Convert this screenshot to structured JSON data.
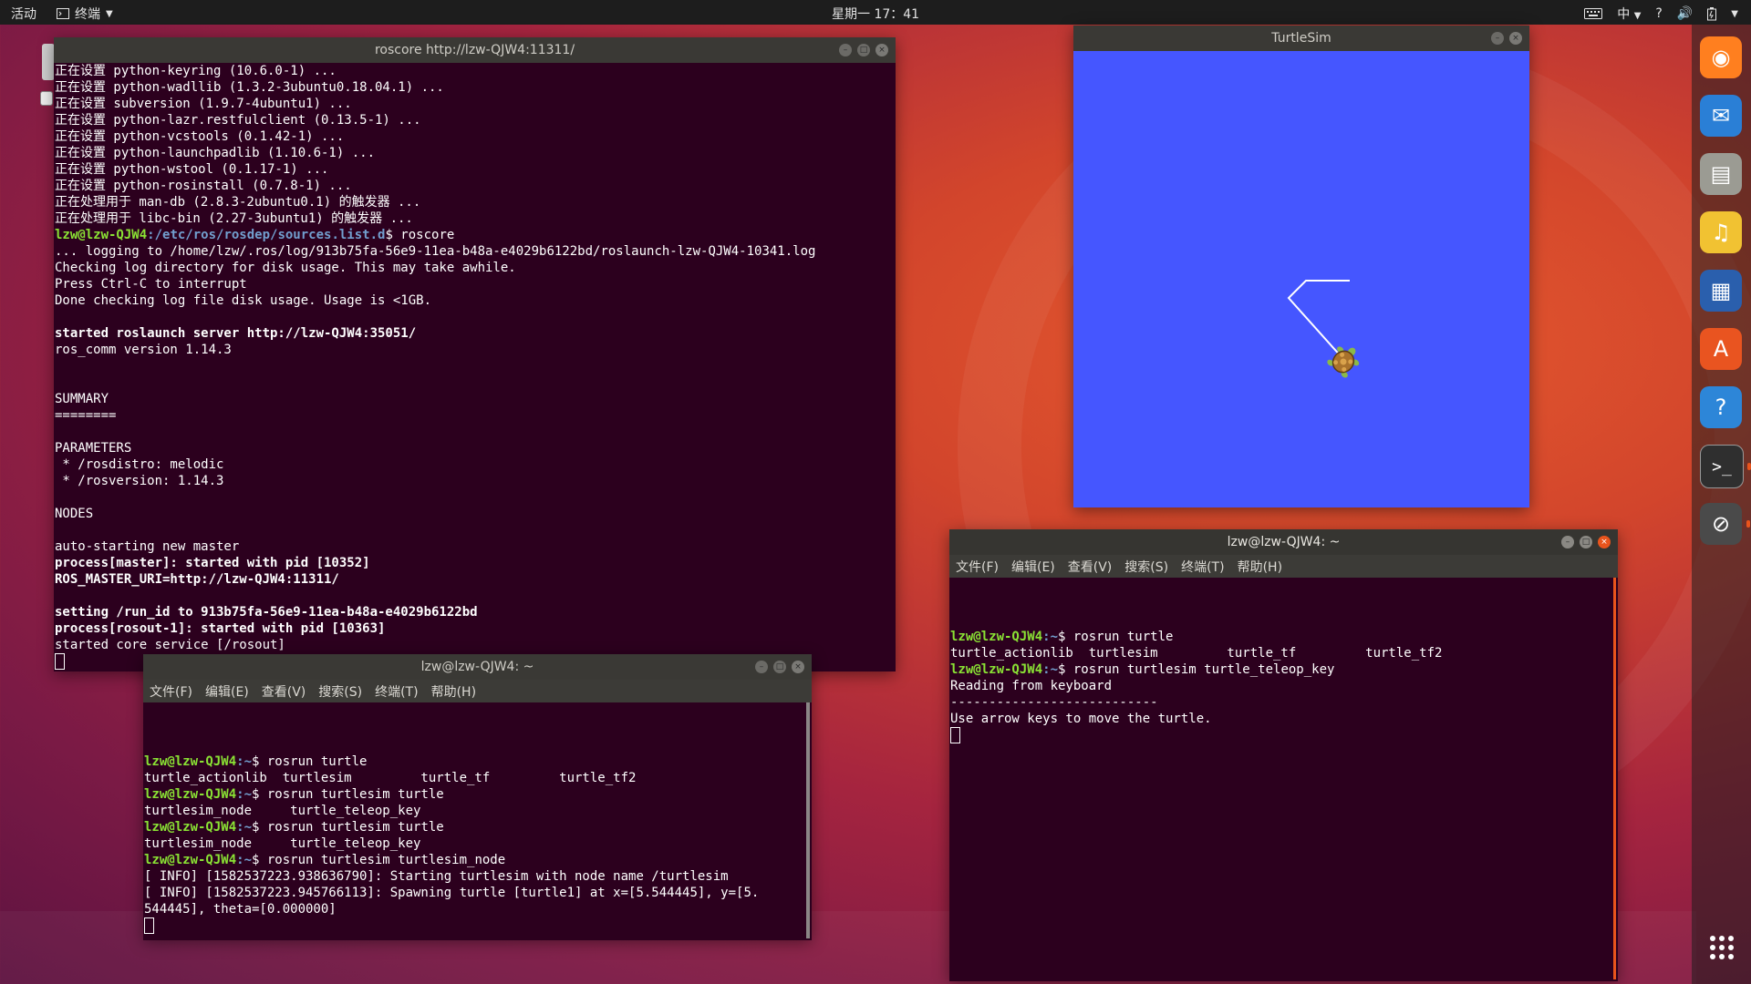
{
  "topbar": {
    "activities": "活动",
    "app_menu": "终端",
    "clock": "星期一 17：41",
    "tray": {
      "keyboard_icon": "keyboard-icon",
      "input_method": "中",
      "help": "?",
      "volume_icon": "volume-icon",
      "battery_icon": "battery-icon",
      "system_menu_icon": "chevron-down-icon"
    }
  },
  "dock": {
    "items": [
      {
        "name": "firefox",
        "icon": "firefox-icon",
        "color": "#ff7f1f"
      },
      {
        "name": "thunderbird",
        "icon": "mail-icon",
        "color": "#2a7fd6"
      },
      {
        "name": "files",
        "icon": "files-icon",
        "color": "#9b9b93"
      },
      {
        "name": "rhythmbox",
        "icon": "music-icon",
        "color": "#f1c232"
      },
      {
        "name": "writer",
        "icon": "document-icon",
        "color": "#2a5fad"
      },
      {
        "name": "software",
        "icon": "software-store-icon",
        "color": "#e95420"
      },
      {
        "name": "help",
        "icon": "help-icon",
        "color": "#2d86d8"
      },
      {
        "name": "terminal",
        "icon": "terminal-icon",
        "color": "#2f2f2f"
      },
      {
        "name": "unknown-app",
        "icon": "blocked-icon",
        "color": "#4a4a4a"
      }
    ]
  },
  "win_roscore": {
    "title": "roscore http://lzw-QJW4:11311/",
    "lines": [
      {
        "t": "正在设置 python-keyring (10.6.0-1) ..."
      },
      {
        "t": "正在设置 python-wadllib (1.3.2-3ubuntu0.18.04.1) ..."
      },
      {
        "t": "正在设置 subversion (1.9.7-4ubuntu1) ..."
      },
      {
        "t": "正在设置 python-lazr.restfulclient (0.13.5-1) ..."
      },
      {
        "t": "正在设置 python-vcstools (0.1.42-1) ..."
      },
      {
        "t": "正在设置 python-launchpadlib (1.10.6-1) ..."
      },
      {
        "t": "正在设置 python-wstool (0.1.17-1) ..."
      },
      {
        "t": "正在设置 python-rosinstall (0.7.8-1) ..."
      },
      {
        "t": "正在处理用于 man-db (2.8.3-2ubuntu0.1) 的触发器 ..."
      },
      {
        "t": "正在处理用于 libc-bin (2.27-3ubuntu1) 的触发器 ..."
      },
      {
        "prompt_user": "lzw@lzw-QJW4",
        "prompt_path": ":/etc/ros/rosdep/sources.list.d",
        "t": "$ roscore"
      },
      {
        "t": "... logging to /home/lzw/.ros/log/913b75fa-56e9-11ea-b48a-e4029b6122bd/roslaunch-lzw-QJW4-10341.log"
      },
      {
        "t": "Checking log directory for disk usage. This may take awhile."
      },
      {
        "t": "Press Ctrl-C to interrupt"
      },
      {
        "t": "Done checking log file disk usage. Usage is <1GB."
      },
      {
        "t": ""
      },
      {
        "t": "started roslaunch server http://lzw-QJW4:35051/",
        "bold": true
      },
      {
        "t": "ros_comm version 1.14.3"
      },
      {
        "t": ""
      },
      {
        "t": ""
      },
      {
        "t": "SUMMARY"
      },
      {
        "t": "========"
      },
      {
        "t": ""
      },
      {
        "t": "PARAMETERS"
      },
      {
        "t": " * /rosdistro: melodic"
      },
      {
        "t": " * /rosversion: 1.14.3"
      },
      {
        "t": ""
      },
      {
        "t": "NODES"
      },
      {
        "t": ""
      },
      {
        "t": "auto-starting new master"
      },
      {
        "t": "process[master]: started with pid [10352]",
        "bold": true
      },
      {
        "t": "ROS_MASTER_URI=http://lzw-QJW4:11311/",
        "bold": true
      },
      {
        "t": ""
      },
      {
        "t": "setting /run_id to 913b75fa-56e9-11ea-b48a-e4029b6122bd",
        "bold": true
      },
      {
        "t": "process[rosout-1]: started with pid [10363]",
        "bold": true
      },
      {
        "t": "started core service [/rosout]"
      },
      {
        "cursor": true
      }
    ]
  },
  "menu_labels": [
    "文件(F)",
    "编辑(E)",
    "查看(V)",
    "搜索(S)",
    "终端(T)",
    "帮助(H)"
  ],
  "win_term1": {
    "title": "lzw@lzw-QJW4: ~",
    "lines": [
      {
        "prompt_user": "lzw@lzw-QJW4",
        "prompt_path": ":~",
        "t": "$ rosrun turtle"
      },
      {
        "t": "turtle_actionlib  turtlesim         turtle_tf         turtle_tf2"
      },
      {
        "prompt_user": "lzw@lzw-QJW4",
        "prompt_path": ":~",
        "t": "$ rosrun turtlesim turtle"
      },
      {
        "t": "turtlesim_node     turtle_teleop_key"
      },
      {
        "prompt_user": "lzw@lzw-QJW4",
        "prompt_path": ":~",
        "t": "$ rosrun turtlesim turtle"
      },
      {
        "t": "turtlesim_node     turtle_teleop_key"
      },
      {
        "prompt_user": "lzw@lzw-QJW4",
        "prompt_path": ":~",
        "t": "$ rosrun turtlesim turtlesim_node"
      },
      {
        "t": "[ INFO] [1582537223.938636790]: Starting turtlesim with node name /turtlesim"
      },
      {
        "t": "[ INFO] [1582537223.945766113]: Spawning turtle [turtle1] at x=[5.544445], y=[5."
      },
      {
        "t": "544445], theta=[0.000000]"
      },
      {
        "cursor": true
      }
    ]
  },
  "win_term2": {
    "title": "lzw@lzw-QJW4: ~",
    "lines": [
      {
        "prompt_user": "lzw@lzw-QJW4",
        "prompt_path": ":~",
        "t": "$ rosrun turtle"
      },
      {
        "t": "turtle_actionlib  turtlesim         turtle_tf         turtle_tf2"
      },
      {
        "prompt_user": "lzw@lzw-QJW4",
        "prompt_path": ":~",
        "t": "$ rosrun turtlesim turtle_teleop_key"
      },
      {
        "t": "Reading from keyboard"
      },
      {
        "t": "---------------------------"
      },
      {
        "t": "Use arrow keys to move the turtle."
      },
      {
        "cursor": true
      }
    ]
  },
  "turtlesim": {
    "title": "TurtleSim",
    "background": "#4556ff",
    "turtle_icon": "turtle-icon",
    "trail_color": "#ffffff"
  },
  "colors": {
    "terminal_bg": "#2c001e",
    "prompt_user": "#8ae234",
    "prompt_path": "#729fcf",
    "accent": "#e9541c"
  }
}
